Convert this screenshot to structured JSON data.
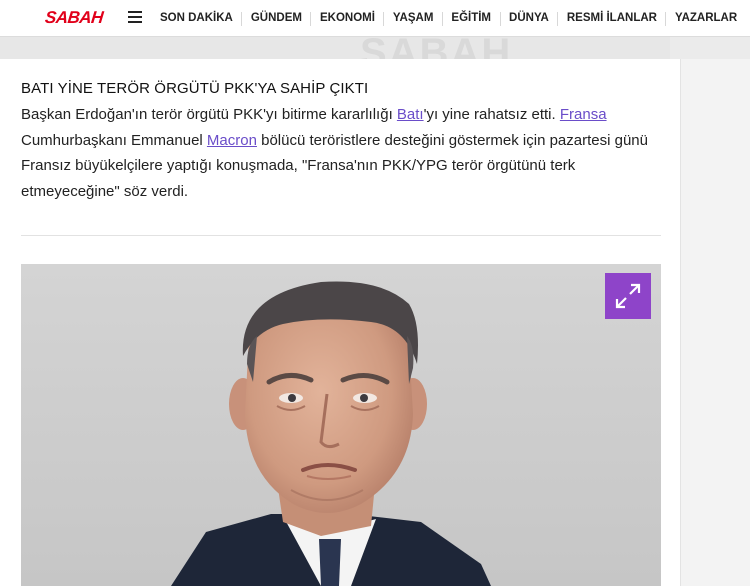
{
  "header": {
    "logo_text": "SABAH",
    "menu_icon": "hamburger-menu-icon",
    "nav_items": [
      "SON DAKİKA",
      "GÜNDEM",
      "EKONOMİ",
      "YAŞAM",
      "EĞİTİM",
      "DÜNYA",
      "RESMİ İLANLAR",
      "YAZARLAR"
    ]
  },
  "watermark": "SABAH",
  "article": {
    "headline": "BATI YİNE TERÖR ÖRGÜTÜ PKK'YA SAHİP ÇIKTI",
    "p_part1": "Başkan Erdoğan'ın terör örgütü PKK'yı bitirme kararlılığı ",
    "link_bati": "Batı",
    "p_part2": "'yı yine rahatsız etti. ",
    "link_fransa": "Fransa",
    "p_part3": " Cumhurbaşkanı Emmanuel ",
    "link_macron": "Macron",
    "p_part4": " bölücü teröristlere desteğini göstermek için pazartesi günü Fransız büyükelçilere yaptığı konuşmada, \"Fransa'nın PKK/YPG terör örgütünü terk etmeyeceğine\" söz verdi."
  },
  "photo": {
    "expand_icon": "expand-arrows-icon"
  },
  "colors": {
    "brand_red": "#e1001a",
    "link": "#6a4dc9",
    "expand_button": "#8e44c9"
  }
}
